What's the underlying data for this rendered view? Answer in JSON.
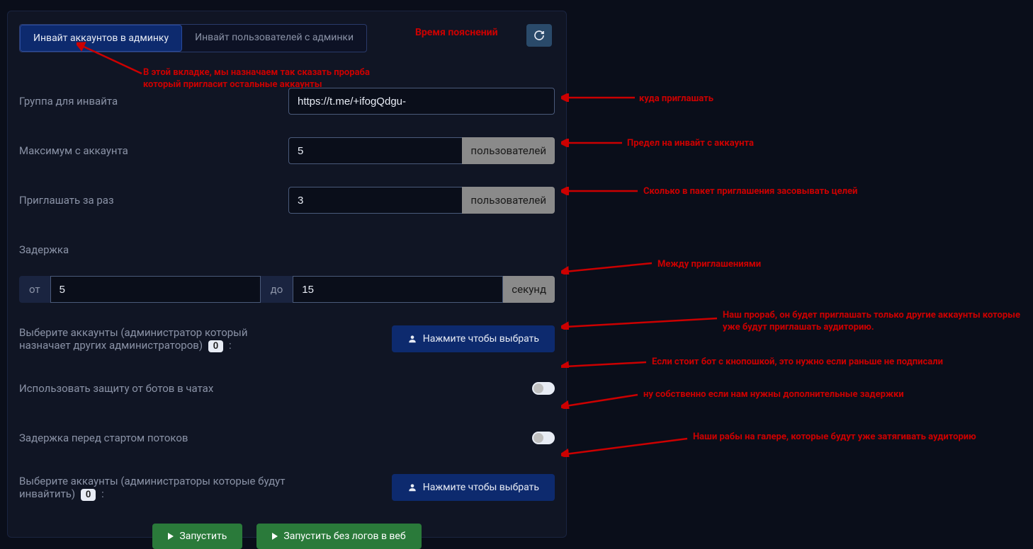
{
  "header": {
    "tab_active": "Инвайт аккаунтов в админку",
    "tab_inactive": "Инвайт пользователей с админки",
    "annotation_title": "Время пояснений"
  },
  "fields": {
    "group_label": "Группа для инвайта",
    "group_value": "https://t.me/+ifogQdgu-",
    "max_label": "Максимум с аккаунта",
    "max_value": "5",
    "max_suffix": "пользователей",
    "batch_label": "Приглашать за раз",
    "batch_value": "3",
    "batch_suffix": "пользователей",
    "delay_label": "Задержка",
    "delay_from_prefix": "от",
    "delay_from_value": "5",
    "delay_to_prefix": "до",
    "delay_to_value": "15",
    "delay_suffix": "секунд",
    "select1_label_a": "Выберите аккаунты (администратор который назначает других администраторов)",
    "select1_badge": "0",
    "select1_colon": ":",
    "select_btn": "Нажмите чтобы выбрать",
    "bot_protect_label": "Использовать защиту от ботов в чатах",
    "delay_threads_label": "Задержка перед стартом потоков",
    "select2_label": "Выберите аккаунты (администраторы которые будут инвайтить)",
    "select2_badge": "0",
    "select2_colon": ":"
  },
  "buttons": {
    "run": "Запустить",
    "run_noweb": "Запустить без логов в веб"
  },
  "annotations": {
    "a_tabs": "В этой вкладке, мы назначаем так сказать прораба который пригласит остальные аккаунты",
    "a_group": "куда приглашать",
    "a_max": "Предел на инвайт с аккаунта",
    "a_batch": "Сколько в пакет приглашения засовывать целей",
    "a_delay": "Между приглашениями",
    "a_select1": "Наш прораб, он будет приглашать только другие аккаунты которые уже будут приглашать аудиторию.",
    "a_bot": "Если стоит бот с кнопошкой, это нужно если раньше не подписали",
    "a_threads": "ну собственно если нам нужны дополнительные задержки",
    "a_select2": "Наши рабы на галере, которые будут уже затягивать аудиторию"
  }
}
